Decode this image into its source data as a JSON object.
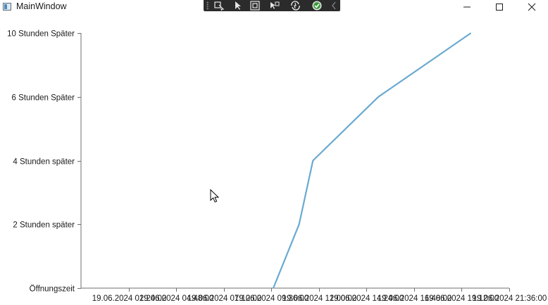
{
  "window": {
    "title": "MainWindow",
    "icons": {
      "app": "window-app-icon",
      "minimize": "minimize-icon",
      "maximize": "maximize-icon",
      "close": "close-icon"
    }
  },
  "debug_toolbar": {
    "icons": [
      "select-element-icon",
      "cursor-select-icon",
      "display-layout-adorners-icon",
      "track-focused-element-icon",
      "hot-reload-icon",
      "binding-ok-icon",
      "collapse-toolbar-icon"
    ]
  },
  "chart_data": {
    "type": "line",
    "title": "",
    "xlabel": "",
    "ylabel": "",
    "x_ticks": [
      "19.06.2024 02:24:00",
      "19.06.2024 04:48:00",
      "19.06.2024 07:12:00",
      "19.06.2024 09:36:00",
      "19.06.2024 12:00:00",
      "19.06.2024 14:24:00",
      "19.06.2024 16:48:00",
      "19.06.2024 19:12:00",
      "19.06.2024 21:36:00"
    ],
    "xlim": [
      "19.06.2024 00:00:00",
      "19.06.2024 21:36:00"
    ],
    "y_ticks": [
      {
        "label": "Öffnungszeit",
        "value": 0
      },
      {
        "label": "2 Stunden später",
        "value": 2
      },
      {
        "label": "4 Stunden später",
        "value": 4
      },
      {
        "label": "6 Stunden Später",
        "value": 6
      },
      {
        "label": "10 Stunden Später",
        "value": 8
      }
    ],
    "ylim": [
      0,
      8
    ],
    "series": [
      {
        "color": "#6aaad0",
        "points": [
          {
            "x": "19.06.2024 09:42:00",
            "y": 0
          },
          {
            "x": "19.06.2024 11:00:00",
            "y": 2
          },
          {
            "x": "19.06.2024 11:42:00",
            "y": 4
          },
          {
            "x": "19.06.2024 15:00:00",
            "y": 6
          },
          {
            "x": "19.06.2024 19:40:00",
            "y": 8
          }
        ]
      }
    ],
    "grid": false,
    "legend": "none"
  }
}
